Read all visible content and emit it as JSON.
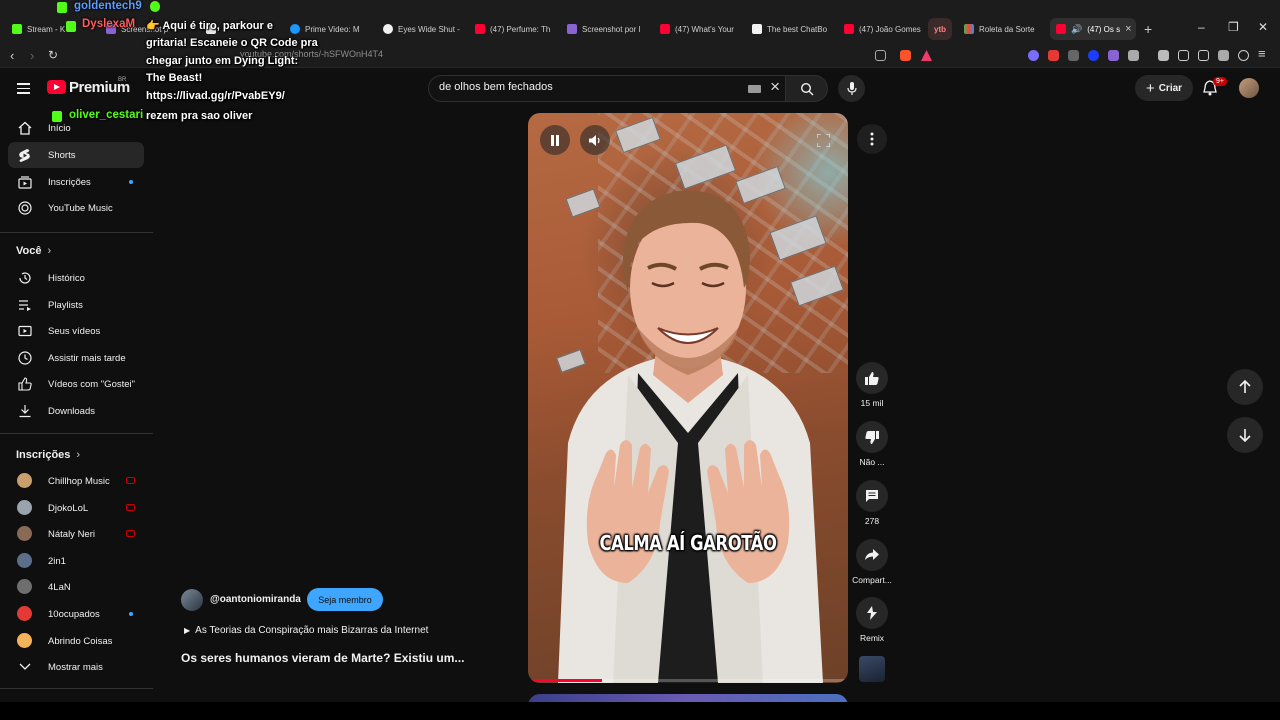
{
  "browser": {
    "tabs": [
      {
        "label": "Stream - K D",
        "icon_color": "#53fc18"
      },
      {
        "label": "Screenshot p",
        "icon_color": "#8a63d2"
      },
      {
        "label": "",
        "icon_color": "#e8e8e8"
      },
      {
        "label": "Prime Video: M",
        "icon_color": "#1a98ff"
      },
      {
        "label": "Eyes Wide Shut -",
        "icon_color": "#f1f1f1"
      },
      {
        "label": "(47) Perfume: Th",
        "icon_color": "#ff0033"
      },
      {
        "label": "Screenshot por l",
        "icon_color": "#8a63d2"
      },
      {
        "label": "(47) What's Your",
        "icon_color": "#ff0033"
      },
      {
        "label": "The best ChatBo",
        "icon_color": "#f1f1f1"
      },
      {
        "label": "(47) João Gomes",
        "icon_color": "#ff0033"
      },
      {
        "label": "ytb",
        "icon_color": "#ff6b6b"
      },
      {
        "label": "Roleta da Sorte",
        "icon_color": "#4caf50"
      },
      {
        "label": "(47) Os s",
        "icon_color": "#ff0033"
      }
    ],
    "url": "youtube.com/shorts/-hSFWOnH4T4"
  },
  "stream_chat": {
    "users": [
      "goldentech9",
      "DyslexaM",
      "oliver_cestari"
    ],
    "message_lines": [
      "👉 Aqui é tiro, parkour e",
      "gritaria! Escaneie o QR Code pra",
      "chegar junto em Dying Light:",
      "The Beast!",
      "https://livad.gg/r/PvabEY9/",
      "rezem pra sao oliver"
    ]
  },
  "masthead": {
    "logo_text": "Premium",
    "region": "BR",
    "search_value": "de olhos bem fechados",
    "create_label": "Criar",
    "notifications_badge": "9+"
  },
  "sidebar": {
    "main": [
      {
        "label": "Início",
        "icon": "home-icon"
      },
      {
        "label": "Shorts",
        "icon": "shorts-icon",
        "active": true
      },
      {
        "label": "Inscrições",
        "icon": "subscriptions-icon",
        "dot": true
      },
      {
        "label": "YouTube Music",
        "icon": "music-icon"
      }
    ],
    "you_heading": "Você",
    "you_items": [
      {
        "label": "Histórico",
        "icon": "history-icon"
      },
      {
        "label": "Playlists",
        "icon": "playlists-icon"
      },
      {
        "label": "Seus vídeos",
        "icon": "your-videos-icon"
      },
      {
        "label": "Assistir mais tarde",
        "icon": "watch-later-icon"
      },
      {
        "label": "Vídeos com \"Gostei\"",
        "icon": "liked-icon"
      },
      {
        "label": "Downloads",
        "icon": "download-icon"
      }
    ],
    "subs_heading": "Inscrições",
    "subs": [
      {
        "label": "Chillhop Music",
        "live": true,
        "color": "#c9a06b"
      },
      {
        "label": "DjokoLoL",
        "live": true,
        "color": "#9aa3ad"
      },
      {
        "label": "Nátaly Neri",
        "live": true,
        "color": "#8b6a55"
      },
      {
        "label": "2in1",
        "live": false,
        "color": "#5c6f8a"
      },
      {
        "label": "4LaN",
        "live": false,
        "color": "#6e6e6e"
      },
      {
        "label": "10ocupados",
        "live": false,
        "dot": true,
        "color": "#e53935"
      },
      {
        "label": "Abrindo Coisas",
        "live": false,
        "color": "#f2b35a"
      }
    ],
    "show_more": "Mostrar mais"
  },
  "short": {
    "caption": "CALMA AÍ GAROTÃO",
    "progress": 0.23,
    "channel_handle": "@oantoniomiranda",
    "join_label": "Seja membro",
    "playlist": "As Teorias da Conspiração mais Bizarras da Internet",
    "title": "Os seres humanos vieram de Marte? Existiu um..."
  },
  "actions": {
    "likes": "15 mil",
    "dislike": "Não ...",
    "comments": "278",
    "share": "Compart...",
    "remix": "Remix"
  }
}
